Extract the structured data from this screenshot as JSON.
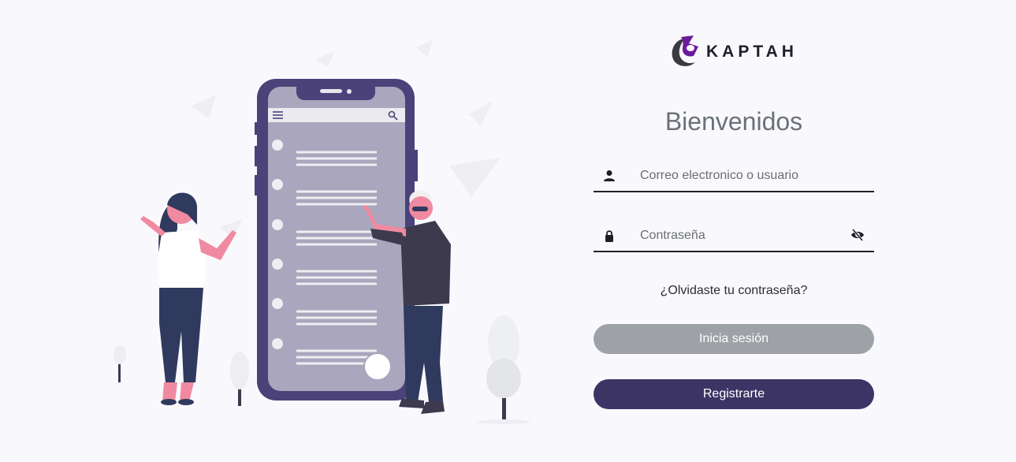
{
  "brand": {
    "name": "KAPTAH",
    "accent_color": "#6a1b9a",
    "dark_color": "#3d3466"
  },
  "login": {
    "heading": "Bienvenidos",
    "email_placeholder": "Correo electronico o usuario",
    "email_value": "",
    "password_placeholder": "Contraseña",
    "password_value": "",
    "forgot_link": "¿Olvidaste tu contraseña?",
    "login_button": "Inicia sesión",
    "register_button": "Registrarte",
    "login_button_color": "#9ea1a6",
    "register_button_color": "#3d3466"
  },
  "icons": {
    "email": "user-icon",
    "password": "lock-icon",
    "toggle_visibility": "eye-slash-icon",
    "menu": "hamburger-icon",
    "search": "search-icon"
  }
}
